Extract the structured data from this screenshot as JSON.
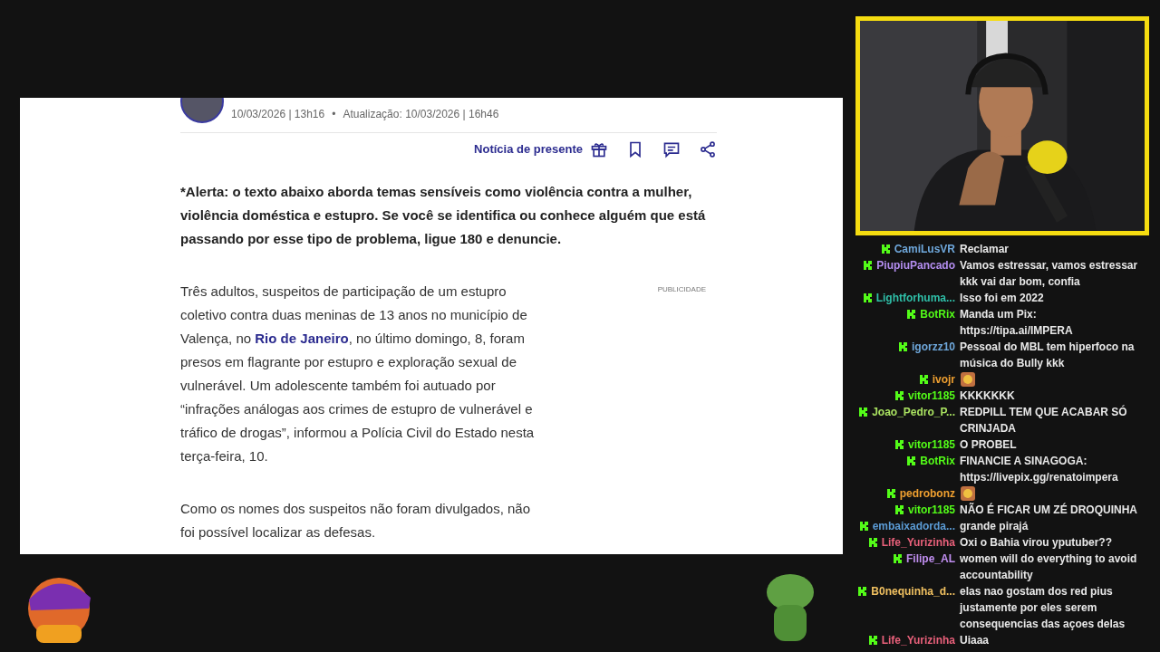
{
  "article": {
    "dates": "10/03/2026 | 13h16",
    "separator": "•",
    "updated": "Atualização: 10/03/2026 | 16h46",
    "gift_label": "Notícia de presente",
    "alert": "*Alerta: o texto abaixo aborda temas sensíveis como violência contra a mulher, violência doméstica e estupro. Se você se identifica ou conhece alguém que está passando por esse tipo de problema, ligue 180 e denuncie.",
    "ad_label": "PUBLICIDADE",
    "paragraphs": [
      {
        "before": "Três adultos, suspeitos de participação de um estupro coletivo contra duas meninas de 13 anos no município de Valença, no ",
        "link": "Rio de Janeiro",
        "after": ", no último domingo, 8, foram presos em flagrante por estupro e exploração sexual de vulnerável. Um adolescente também foi autuado por “infrações análogas aos crimes de estupro de vulnerável e tráfico de drogas”, informou a Polícia Civil do Estado nesta terça-feira, 10."
      },
      {
        "before": "Como os nomes dos suspeitos não foram divulgados, não foi possível localizar as defesas."
      }
    ]
  },
  "chat": [
    {
      "user": "CamiLusVR",
      "color": "#6fa8dc",
      "kind": "text",
      "message": "Reclamar"
    },
    {
      "user": "PiupiuPancado",
      "color": "#b48ef0",
      "kind": "text",
      "message": "Vamos estressar, vamos estressar kkk vai dar bom, confia"
    },
    {
      "user": "Lightforhuma...",
      "color": "#2fbfa8",
      "kind": "text",
      "message": "Isso foi em 2022"
    },
    {
      "user": "BotRix",
      "color": "#53fc18",
      "kind": "text",
      "message": "Manda um Pix: https://tipa.ai/IMPERA"
    },
    {
      "user": "igorzz10",
      "color": "#6fa8dc",
      "kind": "text",
      "message": "Pessoal do MBL tem hiperfoco na música do Bully kkk"
    },
    {
      "user": "ivojr",
      "color": "#f0a030",
      "kind": "emote"
    },
    {
      "user": "vitor1185",
      "color": "#53fc18",
      "kind": "text",
      "message": "KKKKKKK"
    },
    {
      "user": "Joao_Pedro_P...",
      "color": "#a8e060",
      "kind": "text",
      "message": "REDPILL TEM QUE ACABAR SÓ CRINJADA"
    },
    {
      "user": "vitor1185",
      "color": "#53fc18",
      "kind": "text",
      "message": "O PROBEL"
    },
    {
      "user": "BotRix",
      "color": "#53fc18",
      "kind": "text",
      "message": "FINANCIE A SINAGOGA: https://livepix.gg/renatoimpera"
    },
    {
      "user": "pedrobonz",
      "color": "#f0a030",
      "kind": "emote"
    },
    {
      "user": "vitor1185",
      "color": "#53fc18",
      "kind": "text",
      "message": "NÃO É FICAR UM ZÉ DROQUINHA"
    },
    {
      "user": "embaixadorda...",
      "color": "#5b9bd5",
      "kind": "text",
      "message": "grande pirajá"
    },
    {
      "user": "Life_Yurizinha",
      "color": "#e8607a",
      "kind": "text",
      "message": "Oxi o Bahia virou yputuber??"
    },
    {
      "user": "Filipe_AL",
      "color": "#c08ef0",
      "kind": "text",
      "message": "women will do everything to avoid accountability"
    },
    {
      "user": "B0nequinha_d...",
      "color": "#f0c060",
      "kind": "text",
      "message": "elas nao gostam dos red pius justamente por eles serem consequencias das açoes delas"
    },
    {
      "user": "Life_Yurizinha",
      "color": "#e8607a",
      "kind": "text",
      "message": "Uiaaa"
    }
  ]
}
